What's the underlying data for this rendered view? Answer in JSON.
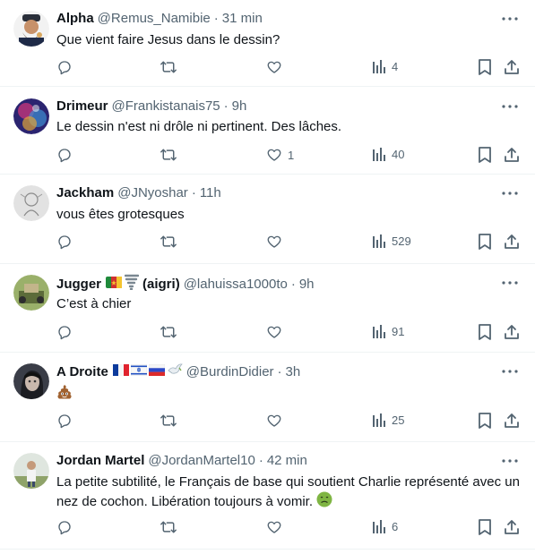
{
  "tweets": [
    {
      "name": "Alpha",
      "handle": "@Remus_Namibie",
      "time": "31 min",
      "text": "Que vient faire Jesus dans le dessin?",
      "replies": "",
      "retweets": "",
      "likes": "",
      "views": "4"
    },
    {
      "name": "Drimeur",
      "handle": "@Frankistanais75",
      "time": "9h",
      "text": "Le dessin n'est ni drôle ni pertinent. Des lâches.",
      "replies": "",
      "retweets": "",
      "likes": "1",
      "views": "40"
    },
    {
      "name": "Jackham",
      "handle": "@JNyoshar",
      "time": "11h",
      "text": "vous êtes grotesques",
      "replies": "",
      "retweets": "",
      "likes": "",
      "views": "529"
    },
    {
      "name": "Jugger",
      "name_suffix": "(aigri)",
      "handle": "@lahuissa1000to",
      "time": "9h",
      "text": "C’est à chier",
      "replies": "",
      "retweets": "",
      "likes": "",
      "views": "91"
    },
    {
      "name": "A Droite",
      "handle": "@BurdinDidier",
      "time": "3h",
      "text": "",
      "text_emoji": "poop-emoji",
      "replies": "",
      "retweets": "",
      "likes": "",
      "views": "25"
    },
    {
      "name": "Jordan Martel",
      "handle": "@JordanMartel10",
      "time": "42 min",
      "text": "La petite subtilité, le Français de base qui soutient Charlie représenté avec un nez de cochon. Libération toujours à vomir.",
      "text_emoji": "nauseated-face-emoji",
      "replies": "",
      "retweets": "",
      "likes": "",
      "views": "6"
    }
  ],
  "separator": "·",
  "icons": {
    "reply": "reply-icon",
    "retweet": "retweet-icon",
    "like": "heart-icon",
    "views": "views-bar-chart-icon",
    "bookmark": "bookmark-icon",
    "share": "share-icon",
    "more": "more-dots-icon"
  },
  "colors": {
    "text": "#0f1419",
    "secondary": "#536471",
    "divider": "#eff3f4"
  }
}
